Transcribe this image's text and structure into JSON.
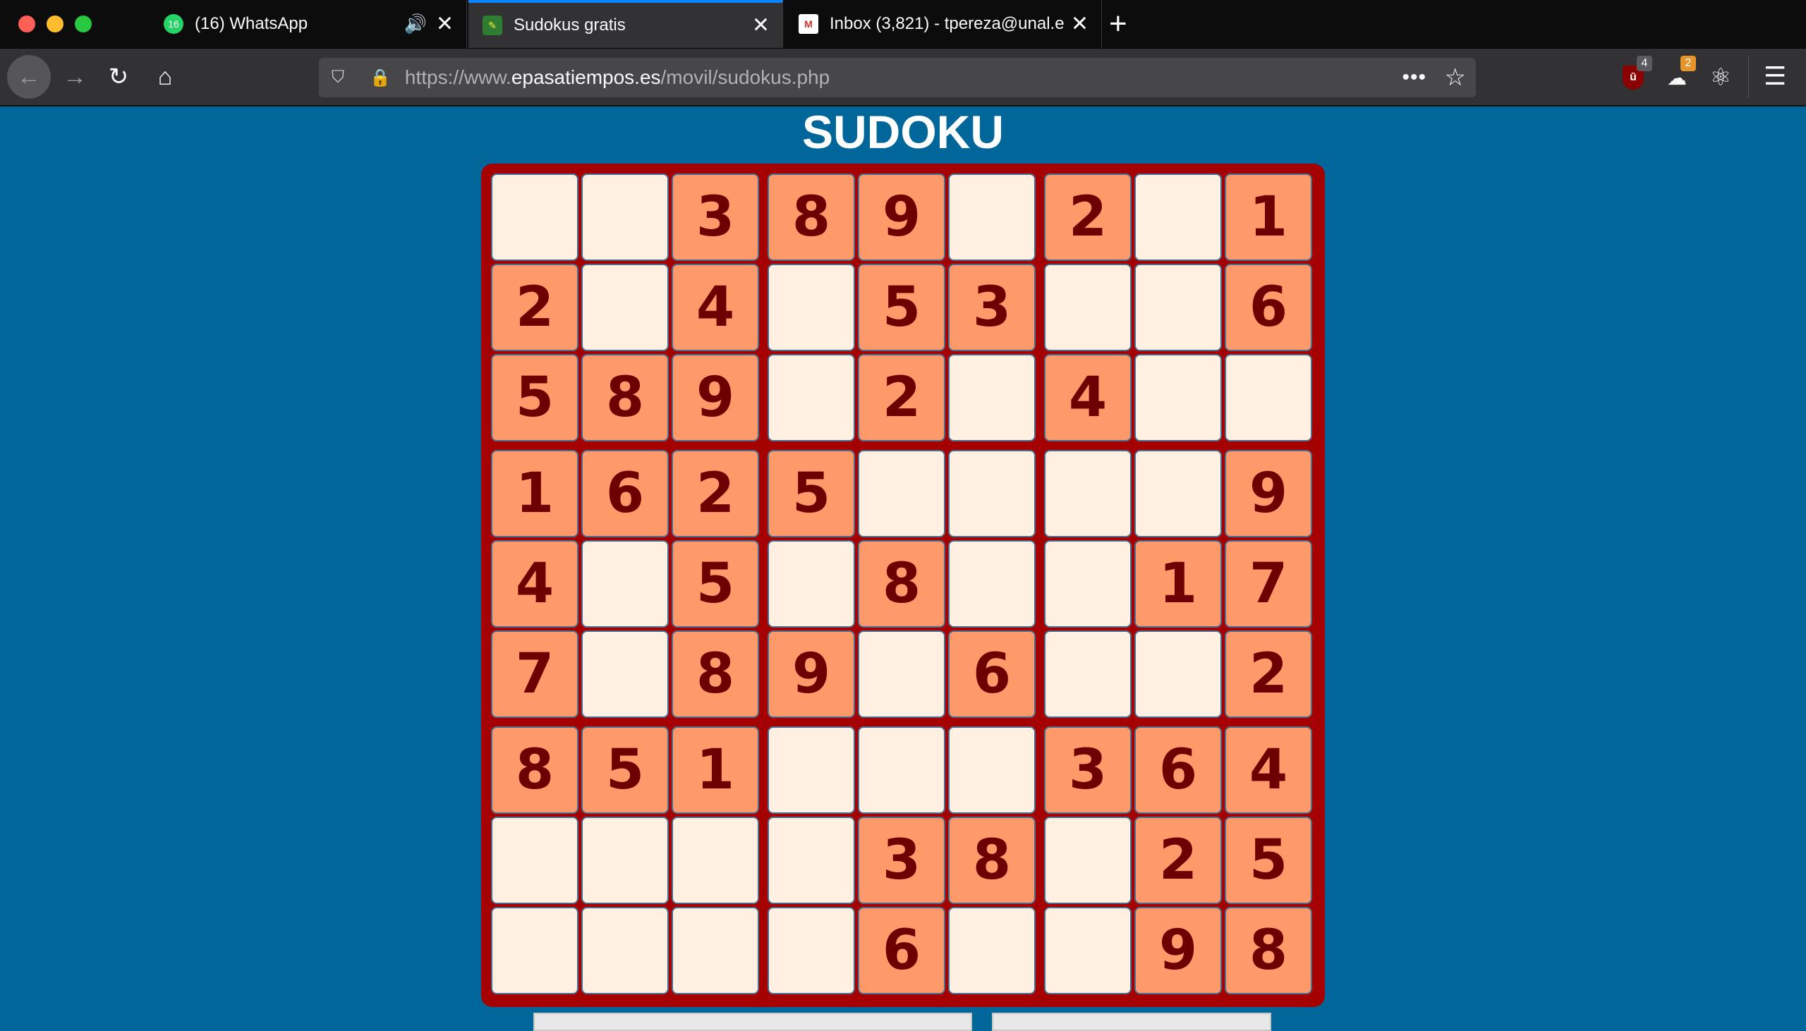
{
  "browser": {
    "tabs": [
      {
        "label": "(16) WhatsApp",
        "favicon_badge": "16",
        "audio": true,
        "active": false
      },
      {
        "label": "Sudokus gratis",
        "active": true
      },
      {
        "label": "Inbox (3,821) - tpereza@unal.e",
        "active": false
      }
    ],
    "new_tab_symbol": "+",
    "url": {
      "prefix": "https://www.",
      "domain": "epasatiempos.es",
      "path": "/movil/sudokus.php"
    },
    "extensions": {
      "ublock_count": "4",
      "second_count": "2"
    }
  },
  "page": {
    "title": "SUDOKU"
  },
  "sudoku": {
    "grid": [
      [
        null,
        null,
        3,
        8,
        9,
        null,
        2,
        null,
        1
      ],
      [
        2,
        null,
        4,
        null,
        5,
        3,
        null,
        null,
        6
      ],
      [
        5,
        8,
        9,
        null,
        2,
        null,
        4,
        null,
        null
      ],
      [
        1,
        6,
        2,
        5,
        null,
        null,
        null,
        null,
        9
      ],
      [
        4,
        null,
        5,
        null,
        8,
        null,
        null,
        1,
        7
      ],
      [
        7,
        null,
        8,
        9,
        null,
        6,
        null,
        null,
        2
      ],
      [
        8,
        5,
        1,
        null,
        null,
        null,
        3,
        6,
        4
      ],
      [
        null,
        null,
        null,
        null,
        3,
        8,
        null,
        2,
        5
      ],
      [
        null,
        null,
        null,
        null,
        6,
        null,
        null,
        9,
        8
      ]
    ],
    "colors": {
      "given_cell": "#fe9a69",
      "empty_cell": "#fff0e2",
      "digit": "#6d0000",
      "frame": "#a50101"
    }
  }
}
